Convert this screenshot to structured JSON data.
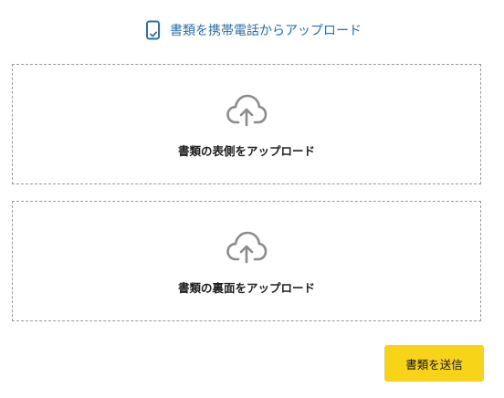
{
  "phone_upload": {
    "label": "書類を携帯電話からアップロード",
    "icon": "phone-check-icon",
    "color": "#2a6fb0"
  },
  "upload_front": {
    "label": "書類の表側をアップロード",
    "icon": "cloud-upload-icon"
  },
  "upload_back": {
    "label": "書類の裏面をアップロード",
    "icon": "cloud-upload-icon"
  },
  "submit": {
    "label": "書類を送信",
    "color": "#f7d418"
  }
}
